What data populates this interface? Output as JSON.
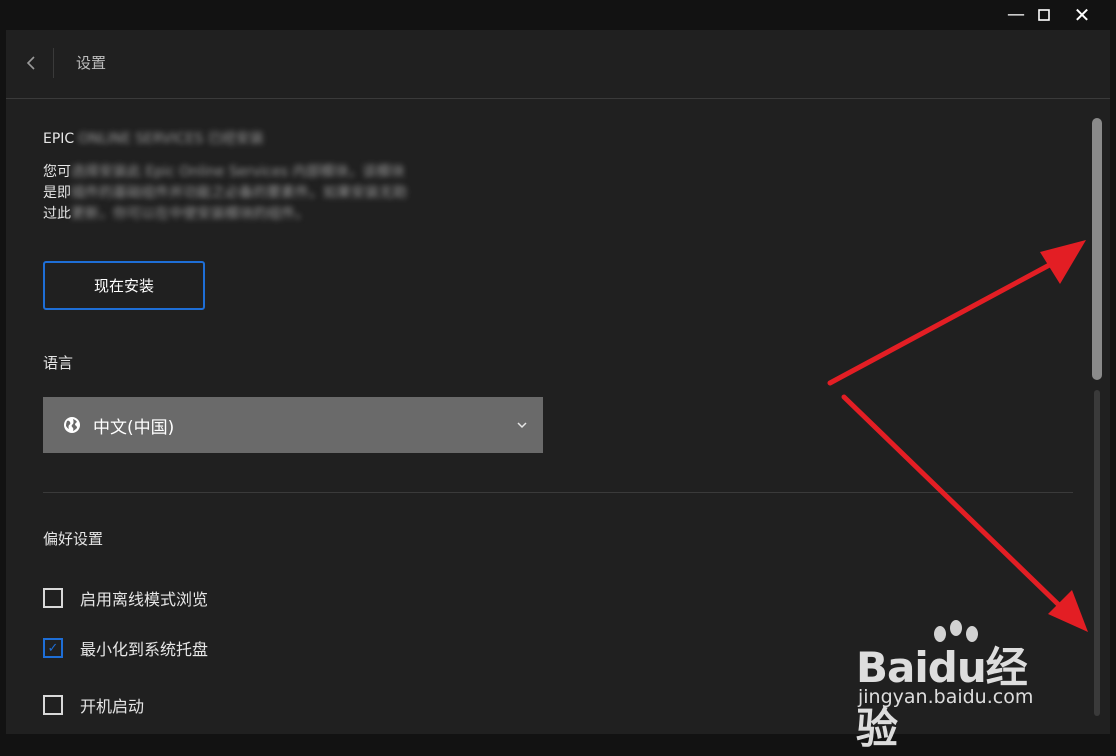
{
  "window": {
    "minimize_icon": "minimize-icon",
    "maximize_icon": "maximize-icon",
    "close_icon": "close-icon"
  },
  "header": {
    "title": "设置",
    "back_icon": "chevron-left-icon"
  },
  "eos": {
    "title": "EPIC",
    "title_blurred": "ONLINE SERVICES 已经安装",
    "desc_lines": [
      {
        "visible": "您可",
        "blurred": "选择安装此 Epic Online Services 内部模块，该模块"
      },
      {
        "visible": "是即",
        "blurred": "插件的基础组件并功能之必备的要素件。如果安装无助"
      },
      {
        "visible": "过此",
        "blurred": "更新，你可以在中使安装模块的组件。"
      }
    ],
    "install_label": "现在安装"
  },
  "language": {
    "label": "语言",
    "selected": "中文(中国)",
    "icon": "globe-icon"
  },
  "preferences": {
    "title": "偏好设置",
    "items": [
      {
        "label": "启用离线模式浏览",
        "checked": false
      },
      {
        "label": "最小化到系统托盘",
        "checked": true
      },
      {
        "label": "开机启动",
        "checked": false
      }
    ]
  },
  "watermark": {
    "brand": "Baidu经验",
    "url": "jingyan.baidu.com"
  },
  "colors": {
    "accent": "#1e6ed6",
    "arrow": "#e31e24",
    "panel": "#202020"
  }
}
